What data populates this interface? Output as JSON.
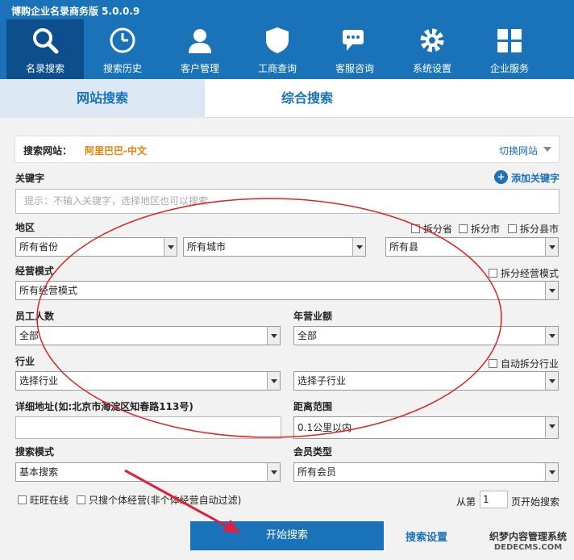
{
  "app": {
    "title": "博购企业名录商务版 5.0.0.9"
  },
  "toolbar": [
    {
      "label": "名录搜索",
      "icon": "search-icon",
      "active": true
    },
    {
      "label": "搜索历史",
      "icon": "clock-icon"
    },
    {
      "label": "客户管理",
      "icon": "user-icon"
    },
    {
      "label": "工商查询",
      "icon": "shield-icon"
    },
    {
      "label": "客服咨询",
      "icon": "chat-icon"
    },
    {
      "label": "系统设置",
      "icon": "gear-icon"
    },
    {
      "label": "企业服务",
      "icon": "grid-icon"
    }
  ],
  "tabs": {
    "website": "网站搜索",
    "combined": "综合搜索"
  },
  "site": {
    "label": "搜索网站：",
    "value": "阿里巴巴-中文",
    "switch": "切换网站"
  },
  "keyword": {
    "label": "关键字",
    "add": "添加关键字",
    "placeholder": "提示：不输入关键字，选择地区也可以搜索"
  },
  "region": {
    "label": "地区",
    "split_province": "拆分省",
    "split_city": "拆分市",
    "split_county": "拆分县市",
    "province": "所有省份",
    "city": "所有城市",
    "county": "所有县"
  },
  "business_mode": {
    "label": "经营模式",
    "split": "拆分经营模式",
    "value": "所有经营模式"
  },
  "employees": {
    "label": "员工人数",
    "value": "全部"
  },
  "revenue": {
    "label": "年营业额",
    "value": "全部"
  },
  "industry": {
    "label": "行业",
    "split": "自动拆分行业",
    "value": "选择行业",
    "sub_value": "选择子行业"
  },
  "address": {
    "label": "详细地址(如:北京市海淀区知春路113号)",
    "value": ""
  },
  "distance": {
    "label": "距离范围",
    "value": "0.1公里以内"
  },
  "search_mode": {
    "label": "搜索模式",
    "value": "基本搜索"
  },
  "member_type": {
    "label": "会员类型",
    "value": "所有会员"
  },
  "options": {
    "wangwang": "旺旺在线",
    "individual": "只搜个体经营(非个体经营自动过滤)"
  },
  "paging": {
    "prefix": "从第",
    "page": "1",
    "suffix": "页开始搜索"
  },
  "actions": {
    "start": "开始搜索",
    "settings": "搜索设置"
  },
  "watermark": {
    "line1": "织梦内容管理系统",
    "line2": "DEDECMS.COM"
  },
  "colors": {
    "brand": "#1a72b8",
    "active": "#0c4f8c",
    "site": "#e8820c"
  }
}
